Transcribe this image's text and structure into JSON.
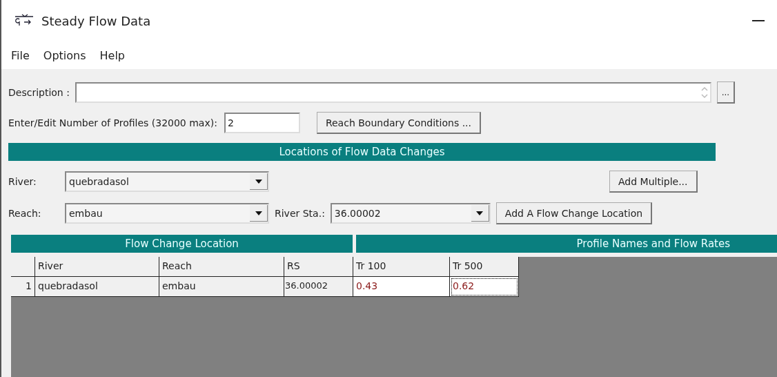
{
  "window": {
    "title": "Steady Flow Data"
  },
  "menu": [
    "File",
    "Options",
    "Help"
  ],
  "description": {
    "label": "Description :",
    "more_button": "..."
  },
  "profiles": {
    "label": "Enter/Edit Number of Profiles (32000 max):",
    "value": "2",
    "button": "Reach Boundary Conditions ..."
  },
  "locations": {
    "title": "Locations of Flow Data Changes",
    "river": {
      "label": "River:",
      "value": "quebradasol"
    },
    "reach": {
      "label": "Reach:",
      "value": "embau"
    },
    "river_station": {
      "label": "River Sta.:",
      "value": "36.00002"
    },
    "add_multiple": "Add Multiple...",
    "add_location": "Add A Flow Change Location"
  },
  "table": {
    "left_title": "Flow Change Location",
    "right_title": "Profile Names and Flow Rates",
    "columns": [
      "River",
      "Reach",
      "RS"
    ],
    "profiles": [
      "Tr 100",
      "Tr 500"
    ],
    "rows": [
      {
        "number": "1",
        "river": "quebradasol",
        "reach": "embau",
        "rs": "36.00002",
        "flows": [
          {
            "value": "0.43",
            "selected": false
          },
          {
            "value": "0.62",
            "selected": true
          }
        ]
      }
    ]
  }
}
